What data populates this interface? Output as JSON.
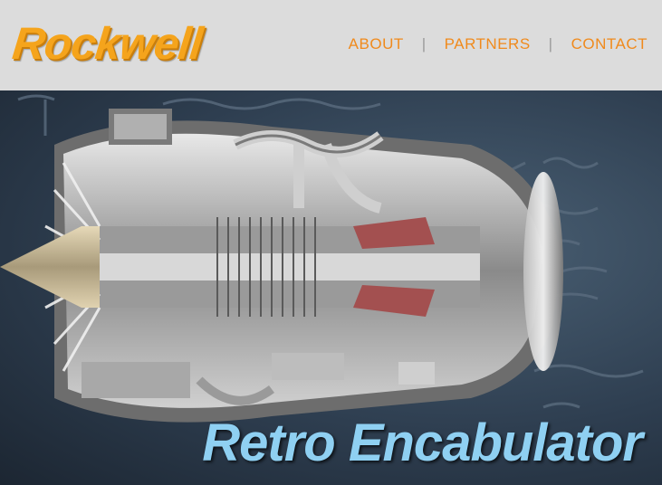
{
  "header": {
    "logo_text": "Rockwell",
    "nav": [
      {
        "label": "ABOUT"
      },
      {
        "label": "PARTNERS"
      },
      {
        "label": "CONTACT"
      }
    ],
    "separator": "|"
  },
  "hero": {
    "title": "Retro Encabulator",
    "image_subject": "turbofan-engine-cutaway"
  },
  "colors": {
    "header_bg": "#dcdcdc",
    "logo": "#f5a41c",
    "nav_link": "#f08a1c",
    "hero_title": "#8fd0f2"
  }
}
